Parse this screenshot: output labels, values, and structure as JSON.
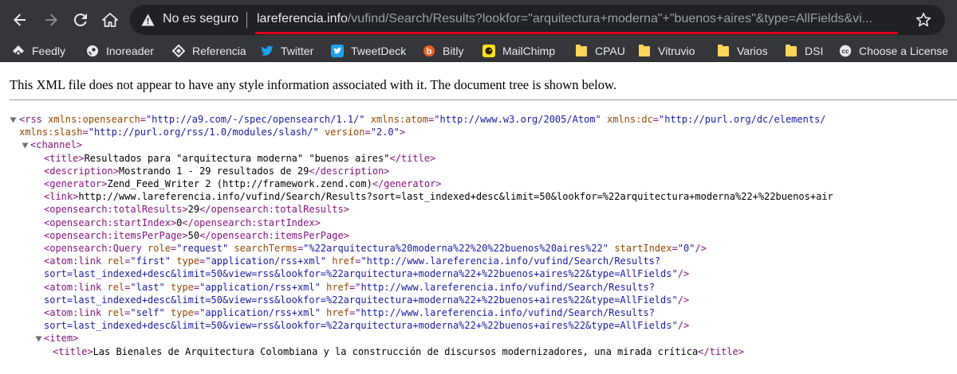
{
  "browser": {
    "security_label": "No es seguro",
    "url_host": "lareferencia.info",
    "url_rest": "/vufind/Search/Results?lookfor=\"arquitectura+moderna\"+\"buenos+aires\"&type=AllFields&vi...",
    "icons": [
      "back-arrow-icon",
      "forward-arrow-icon",
      "reload-icon",
      "home-icon",
      "warning-icon",
      "star-icon"
    ],
    "accent_underline_color": "#e0001b"
  },
  "bookmarks": [
    {
      "label": "Feedly",
      "icon": "feedly-icon"
    },
    {
      "label": "Inoreader",
      "icon": "inoreader-icon"
    },
    {
      "label": "Referencia",
      "icon": "referencia-icon"
    },
    {
      "label": "Twitter",
      "icon": "twitter-icon"
    },
    {
      "label": "TweetDeck",
      "icon": "tweetdeck-icon"
    },
    {
      "label": "Bitly",
      "icon": "bitly-icon"
    },
    {
      "label": "MailChimp",
      "icon": "mailchimp-icon"
    },
    {
      "label": "CPAU",
      "icon": "folder-icon"
    },
    {
      "label": "Vitruvio",
      "icon": "folder-icon"
    },
    {
      "label": "Varios",
      "icon": "folder-icon"
    },
    {
      "label": "DSI",
      "icon": "folder-icon"
    },
    {
      "label": "Choose a License",
      "icon": "creative-commons-icon"
    }
  ],
  "page": {
    "xml_notice": "This XML file does not appear to have any style information associated with it. The document tree is shown below."
  },
  "xml_lines": [
    {
      "collapsible": true,
      "segments": [
        {
          "t": "tag",
          "v": "<rss "
        },
        {
          "t": "aname",
          "v": "xmlns:opensearch"
        },
        {
          "t": "tag",
          "v": "="
        },
        {
          "t": "aval",
          "v": "\"http://a9.com/-/spec/opensearch/1.1/\""
        },
        {
          "t": "tag",
          "v": " "
        },
        {
          "t": "aname",
          "v": "xmlns:atom"
        },
        {
          "t": "tag",
          "v": "="
        },
        {
          "t": "aval",
          "v": "\"http://www.w3.org/2005/Atom\""
        },
        {
          "t": "tag",
          "v": " "
        },
        {
          "t": "aname",
          "v": "xmlns:dc"
        },
        {
          "t": "tag",
          "v": "="
        },
        {
          "t": "aval",
          "v": "\"http://purl.org/dc/elements/"
        }
      ]
    },
    {
      "collapsible": false,
      "segments": [
        {
          "t": "aname",
          "v": "xmlns:slash"
        },
        {
          "t": "tag",
          "v": "="
        },
        {
          "t": "aval",
          "v": "\"http://purl.org/rss/1.0/modules/slash/\""
        },
        {
          "t": "tag",
          "v": " "
        },
        {
          "t": "aname",
          "v": "version"
        },
        {
          "t": "tag",
          "v": "="
        },
        {
          "t": "aval",
          "v": "\"2.0\""
        },
        {
          "t": "tag",
          "v": ">"
        }
      ]
    },
    {
      "collapsible": true,
      "segments": [
        {
          "t": "tag",
          "v": "<channel>"
        }
      ]
    },
    {
      "collapsible": false,
      "segments": [
        {
          "t": "tag",
          "v": "<title>"
        },
        {
          "t": "txt",
          "v": "Resultados para \"arquitectura moderna\" \"buenos aires\""
        },
        {
          "t": "tag",
          "v": "</title>"
        }
      ]
    },
    {
      "collapsible": false,
      "segments": [
        {
          "t": "tag",
          "v": "<description>"
        },
        {
          "t": "txt",
          "v": "Mostrando 1 - 29 resultados de 29"
        },
        {
          "t": "tag",
          "v": "</description>"
        }
      ]
    },
    {
      "collapsible": false,
      "segments": [
        {
          "t": "tag",
          "v": "<generator>"
        },
        {
          "t": "txt",
          "v": "Zend_Feed_Writer 2 (http://framework.zend.com)"
        },
        {
          "t": "tag",
          "v": "</generator>"
        }
      ]
    },
    {
      "collapsible": false,
      "segments": [
        {
          "t": "tag",
          "v": "<link>"
        },
        {
          "t": "txt",
          "v": "http://www.lareferencia.info/vufind/Search/Results?sort=last_indexed+desc&limit=50&lookfor=%22arquitectura+moderna%22+%22buenos+air"
        }
      ]
    },
    {
      "collapsible": false,
      "segments": [
        {
          "t": "tag",
          "v": "<opensearch:totalResults>"
        },
        {
          "t": "txt",
          "v": "29"
        },
        {
          "t": "tag",
          "v": "</opensearch:totalResults>"
        }
      ]
    },
    {
      "collapsible": false,
      "segments": [
        {
          "t": "tag",
          "v": "<opensearch:startIndex>"
        },
        {
          "t": "txt",
          "v": "0"
        },
        {
          "t": "tag",
          "v": "</opensearch:startIndex>"
        }
      ]
    },
    {
      "collapsible": false,
      "segments": [
        {
          "t": "tag",
          "v": "<opensearch:itemsPerPage>"
        },
        {
          "t": "txt",
          "v": "50"
        },
        {
          "t": "tag",
          "v": "</opensearch:itemsPerPage>"
        }
      ]
    },
    {
      "collapsible": false,
      "segments": [
        {
          "t": "tag",
          "v": "<opensearch:Query "
        },
        {
          "t": "aname",
          "v": "role"
        },
        {
          "t": "tag",
          "v": "="
        },
        {
          "t": "aval",
          "v": "\"request\""
        },
        {
          "t": "tag",
          "v": " "
        },
        {
          "t": "aname",
          "v": "searchTerms"
        },
        {
          "t": "tag",
          "v": "="
        },
        {
          "t": "aval",
          "v": "\"%22arquitectura%20moderna%22%20%22buenos%20aires%22\""
        },
        {
          "t": "tag",
          "v": " "
        },
        {
          "t": "aname",
          "v": "startIndex"
        },
        {
          "t": "tag",
          "v": "="
        },
        {
          "t": "aval",
          "v": "\"0\""
        },
        {
          "t": "tag",
          "v": "/>"
        }
      ]
    },
    {
      "collapsible": false,
      "segments": [
        {
          "t": "tag",
          "v": "<atom:link "
        },
        {
          "t": "aname",
          "v": "rel"
        },
        {
          "t": "tag",
          "v": "="
        },
        {
          "t": "aval",
          "v": "\"first\""
        },
        {
          "t": "tag",
          "v": " "
        },
        {
          "t": "aname",
          "v": "type"
        },
        {
          "t": "tag",
          "v": "="
        },
        {
          "t": "aval",
          "v": "\"application/rss+xml\""
        },
        {
          "t": "tag",
          "v": " "
        },
        {
          "t": "aname",
          "v": "href"
        },
        {
          "t": "tag",
          "v": "="
        },
        {
          "t": "aval",
          "v": "\"http://www.lareferencia.info/vufind/Search/Results?"
        }
      ]
    },
    {
      "collapsible": false,
      "segments": [
        {
          "t": "aval",
          "v": "sort=last_indexed+desc&limit=50&view=rss&lookfor=%22arquitectura+moderna%22+%22buenos+aires%22&type=AllFields\""
        },
        {
          "t": "tag",
          "v": "/>"
        }
      ]
    },
    {
      "collapsible": false,
      "segments": [
        {
          "t": "tag",
          "v": "<atom:link "
        },
        {
          "t": "aname",
          "v": "rel"
        },
        {
          "t": "tag",
          "v": "="
        },
        {
          "t": "aval",
          "v": "\"last\""
        },
        {
          "t": "tag",
          "v": " "
        },
        {
          "t": "aname",
          "v": "type"
        },
        {
          "t": "tag",
          "v": "="
        },
        {
          "t": "aval",
          "v": "\"application/rss+xml\""
        },
        {
          "t": "tag",
          "v": " "
        },
        {
          "t": "aname",
          "v": "href"
        },
        {
          "t": "tag",
          "v": "="
        },
        {
          "t": "aval",
          "v": "\"http://www.lareferencia.info/vufind/Search/Results?"
        }
      ]
    },
    {
      "collapsible": false,
      "segments": [
        {
          "t": "aval",
          "v": "sort=last_indexed+desc&limit=50&view=rss&lookfor=%22arquitectura+moderna%22+%22buenos+aires%22&type=AllFields\""
        },
        {
          "t": "tag",
          "v": "/>"
        }
      ]
    },
    {
      "collapsible": false,
      "segments": [
        {
          "t": "tag",
          "v": "<atom:link "
        },
        {
          "t": "aname",
          "v": "rel"
        },
        {
          "t": "tag",
          "v": "="
        },
        {
          "t": "aval",
          "v": "\"self\""
        },
        {
          "t": "tag",
          "v": " "
        },
        {
          "t": "aname",
          "v": "type"
        },
        {
          "t": "tag",
          "v": "="
        },
        {
          "t": "aval",
          "v": "\"application/rss+xml\""
        },
        {
          "t": "tag",
          "v": " "
        },
        {
          "t": "aname",
          "v": "href"
        },
        {
          "t": "tag",
          "v": "="
        },
        {
          "t": "aval",
          "v": "\"http://www.lareferencia.info/vufind/Search/Results?"
        }
      ]
    },
    {
      "collapsible": false,
      "segments": [
        {
          "t": "aval",
          "v": "sort=last_indexed+desc&limit=50&view=rss&lookfor=%22arquitectura+moderna%22+%22buenos+aires%22&type=AllFields\""
        },
        {
          "t": "tag",
          "v": "/>"
        }
      ]
    },
    {
      "collapsible": true,
      "segments": [
        {
          "t": "tag",
          "v": "<item>"
        }
      ]
    },
    {
      "collapsible": false,
      "segments": [
        {
          "t": "tag",
          "v": "<title>"
        },
        {
          "t": "txt",
          "v": "Las Bienales de Arquitectura Colombiana y la construcción de discursos modernizadores, una mirada crítica"
        },
        {
          "t": "tag",
          "v": "</title>"
        }
      ]
    }
  ]
}
